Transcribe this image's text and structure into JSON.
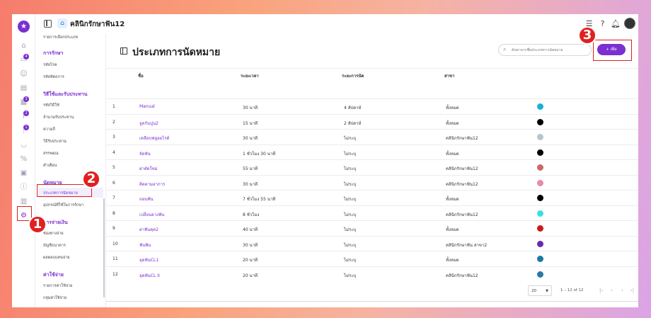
{
  "app": {
    "clinic_name": "คลินิกรักษาฟัน12"
  },
  "rail": {
    "badges": [
      "4",
      "3",
      "2",
      "1"
    ]
  },
  "submenu": {
    "top_item": "รายการเลือกประเภท",
    "groups": [
      {
        "heading": "การรักษา",
        "items": [
          "รหัสโรค",
          "รหัสหัตถการ"
        ]
      },
      {
        "heading": "วิธีใช้และรับประทาน",
        "items": [
          "รหัสวิธีใช้",
          "จำนวนรับประทาน",
          "ความถี่",
          "วิธีรับประทาน",
          "สรรพคุณ",
          "คำเตือน"
        ]
      },
      {
        "heading": "นัดหมาย",
        "items": [
          "ประเภทการนัดหมาย",
          "อุปกรณ์ที่ใช้ในการรักษา"
        ]
      },
      {
        "heading": "การจ่ายเงิน",
        "items": [
          "ช่องทางจ่าย",
          "บัญชีธนาคาร",
          "ผลตอบแทนจ่าย"
        ]
      },
      {
        "heading": "ค่าใช้จ่าย",
        "items": [
          "รายการค่าใช้จ่าย",
          "กลุ่มค่าใช้จ่าย"
        ]
      }
    ]
  },
  "main": {
    "title": "ประเภทการนัดหมาย",
    "search_placeholder": "ค้นหาจากชื่อประเภทการนัดหมาย",
    "add_button": "+ เพิ่ม",
    "columns": [
      "ชื่อ",
      "ระยะเวลา",
      "ระยะการนัด",
      "สาขา"
    ],
    "rows": [
      {
        "no": "1",
        "name": "Manual",
        "duration": "30 นาที",
        "interval": "4 สัปดาห์",
        "branch": "ทั้งหมด",
        "color": "#1ab0d8"
      },
      {
        "no": "2",
        "name": "จูดกันปูน2",
        "duration": "15 นาที",
        "interval": "2 สัปดาห์",
        "branch": "ทั้งหมด",
        "color": "#000000"
      },
      {
        "no": "3",
        "name": "เคลือบฟลูออไรด์",
        "duration": "30 นาที",
        "interval": "ไม่ระบุ",
        "branch": "คลินิกรักษาฟัน12",
        "color": "#b9c4cc"
      },
      {
        "no": "4",
        "name": "จัดฟัน",
        "duration": "1 ชั่วโมง 30 นาที",
        "interval": "ไม่ระบุ",
        "branch": "ทั้งหมด",
        "color": "#000000"
      },
      {
        "no": "5",
        "name": "ผ่าตัดใหม่",
        "duration": "55 นาที",
        "interval": "ไม่ระบุ",
        "branch": "คลินิกรักษาฟัน12",
        "color": "#c96a6a"
      },
      {
        "no": "6",
        "name": "ติดตามอาการ",
        "duration": "30 นาที",
        "interval": "ไม่ระบุ",
        "branch": "คลินิกรักษาฟัน12",
        "color": "#e98aa8"
      },
      {
        "no": "7",
        "name": "ถอนฟัน",
        "duration": "7 ชั่วโมง 55 นาที",
        "interval": "ไม่ระบุ",
        "branch": "ทั้งหมด",
        "color": "#000000"
      },
      {
        "no": "8",
        "name": "เปลี่ยนยางฟัน",
        "duration": "8 ชั่วโมง",
        "interval": "ไม่ระบุ",
        "branch": "คลินิกรักษาฟัน12",
        "color": "#3ae0e0"
      },
      {
        "no": "9",
        "name": "ผ่าฟันคุด2",
        "duration": "40 นาที",
        "interval": "ไม่ระบุ",
        "branch": "ทั้งหมด",
        "color": "#cc1a1a"
      },
      {
        "no": "10",
        "name": "ฟันพิน",
        "duration": "30 นาที",
        "interval": "ไม่ระบุ",
        "branch": "คลินิกรักษาฟัน สาขา2",
        "color": "#6a2aa8"
      },
      {
        "no": "11",
        "name": "อุดฟันCL1",
        "duration": "20 นาที",
        "interval": "ไม่ระบุ",
        "branch": "ทั้งหมด",
        "color": "#1a7aa8"
      },
      {
        "no": "12",
        "name": "อุดฟันCL II",
        "duration": "20 นาที",
        "interval": "ไม่ระบุ",
        "branch": "คลินิกรักษาฟัน12",
        "color": "#2a7aa8"
      }
    ],
    "pager": {
      "page_size": "20",
      "range_text": "1 – 12 of 12"
    }
  },
  "annotations": {
    "step1": "1",
    "step2": "2",
    "step3": "3"
  },
  "colors": {
    "accent": "#7b2fd1",
    "callout": "#e02020"
  }
}
